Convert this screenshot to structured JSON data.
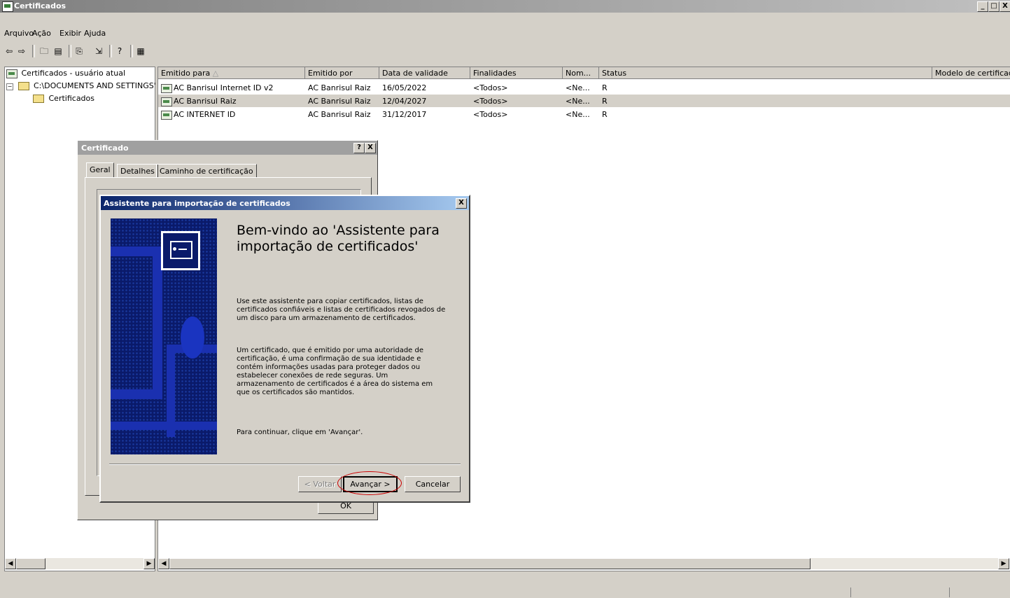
{
  "window": {
    "title": "Certificados",
    "controls": [
      "_",
      "□",
      "X"
    ]
  },
  "menu": [
    "Arquivo",
    "Ação",
    "Exibir",
    "Ajuda"
  ],
  "toolbar_icons": [
    "back-icon",
    "forward-icon",
    "up-folder-icon",
    "show-tree-icon",
    "copy-icon",
    "export-icon",
    "help-icon",
    "properties-icon"
  ],
  "tree": {
    "root": "Certificados - usuário atual",
    "child": "C:\\DOCUMENTS AND SETTINGS'",
    "leaf": "Certificados"
  },
  "table": {
    "columns": [
      "Emitido para",
      "Emitido por",
      "Data de validade",
      "Finalidades",
      "Nom...",
      "Status",
      "Modelo de certificado"
    ],
    "rows": [
      [
        "AC Banrisul Internet ID v2",
        "AC Banrisul Raiz",
        "16/05/2022",
        "<Todos>",
        "<Ne...",
        "R"
      ],
      [
        "AC Banrisul Raiz",
        "AC Banrisul Raiz",
        "12/04/2027",
        "<Todos>",
        "<Ne...",
        "R"
      ],
      [
        "AC INTERNET ID",
        "AC Banrisul Raiz",
        "31/12/2017",
        "<Todos>",
        "<Ne...",
        "R"
      ]
    ]
  },
  "cert_dialog": {
    "title": "Certificado",
    "help_btn": "?",
    "close_btn": "X",
    "tabs": [
      "Geral",
      "Detalhes",
      "Caminho de certificação"
    ],
    "ok_button": "OK"
  },
  "wizard": {
    "title": "Assistente para importação de certificados",
    "close_btn": "X",
    "heading": "Bem-vindo ao 'Assistente para importação de certificados'",
    "para1": "Use este assistente para copiar certificados, listas de certificados confiáveis e listas de certificados revogados de um disco para um armazenamento de certificados.",
    "para2": "Um certificado, que é emitido por uma autoridade de certificação, é uma confirmação de sua identidade e contém informações usadas para proteger dados ou estabelecer conexões de rede seguras. Um armazenamento de certificados é a área do sistema em que os certificados são mantidos.",
    "para3": "Para continuar, clique em 'Avançar'.",
    "back_button": "< Voltar",
    "next_button": "Avançar >",
    "cancel_button": "Cancelar",
    "highlight_color": "#cc0000"
  },
  "colors": {
    "face": "#d4d0c8",
    "active_title": "#0a246a",
    "inactive_title": "#808080"
  }
}
